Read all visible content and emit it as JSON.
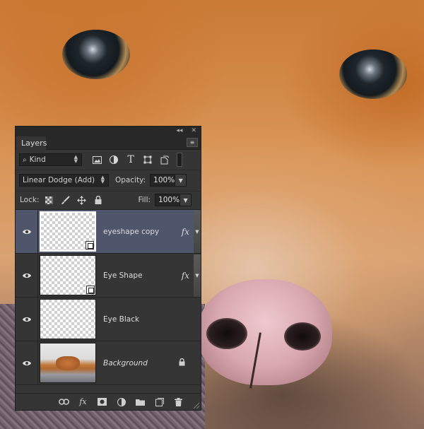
{
  "panel": {
    "tab_label": "Layers",
    "collapse_glyph": "◂◂",
    "close_glyph": "✕",
    "menu_glyph": "≡"
  },
  "filter": {
    "kind_label": "Kind",
    "icons": [
      "image-filter-icon",
      "adjustment-filter-icon",
      "type-filter-icon",
      "shape-filter-icon",
      "smart-object-filter-icon"
    ]
  },
  "blend": {
    "mode": "Linear Dodge (Add)",
    "opacity_label": "Opacity:",
    "opacity_value": "100%",
    "fill_label": "Fill:",
    "fill_value": "100%",
    "lock_label": "Lock:"
  },
  "layers": [
    {
      "name": "eyeshape copy",
      "selected": true,
      "fx": "fx",
      "type": "shape"
    },
    {
      "name": "Eye Shape",
      "selected": false,
      "fx": "fx",
      "type": "shape"
    },
    {
      "name": "Eye Black",
      "selected": false,
      "fx": "",
      "type": "pixel"
    },
    {
      "name": "Background",
      "selected": false,
      "fx": "",
      "type": "background",
      "locked": true
    }
  ],
  "bottom_bar": {
    "icons": [
      "link-layers-icon",
      "add-layer-style-icon",
      "add-mask-icon",
      "new-adjustment-layer-icon",
      "new-group-icon",
      "new-layer-icon",
      "delete-layer-icon"
    ]
  },
  "colors": {
    "panel_bg": "#353535",
    "selected_layer": "#4f566b"
  }
}
